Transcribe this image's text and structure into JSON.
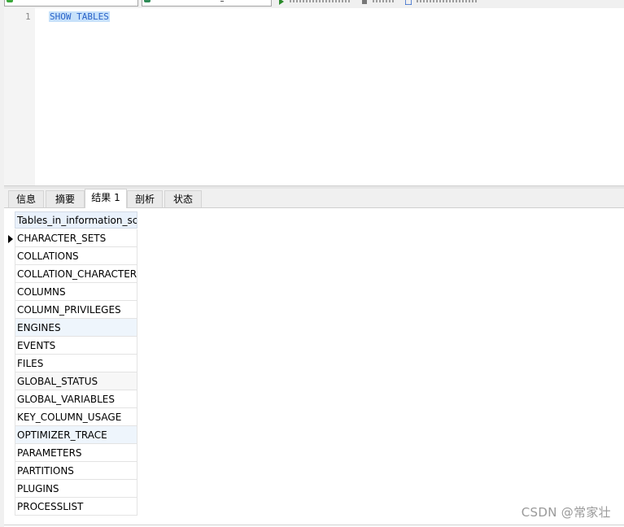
{
  "toolbar": {
    "connection_icon_color": "#3aa83a",
    "database_icon_color": "#2e8b57",
    "run_icon": "play-icon"
  },
  "editor": {
    "line_number": "1",
    "query": "SHOW TABLES"
  },
  "tabs": [
    {
      "label": "信息"
    },
    {
      "label": "摘要"
    },
    {
      "label": "结果 1"
    },
    {
      "label": "剖析"
    },
    {
      "label": "状态"
    }
  ],
  "results": {
    "column_header": "Tables_in_information_schema",
    "rows": [
      "CHARACTER_SETS",
      "COLLATIONS",
      "COLLATION_CHARACTER_SET_APPLICABILITY",
      "COLUMNS",
      "COLUMN_PRIVILEGES",
      "ENGINES",
      "EVENTS",
      "FILES",
      "GLOBAL_STATUS",
      "GLOBAL_VARIABLES",
      "KEY_COLUMN_USAGE",
      "OPTIMIZER_TRACE",
      "PARAMETERS",
      "PARTITIONS",
      "PLUGINS",
      "PROCESSLIST"
    ]
  },
  "watermark": "CSDN @常家壮",
  "colors": {
    "selection": "#c7e1fa",
    "keyword": "#2a63c9",
    "header_bg": "#e9f1fb"
  }
}
